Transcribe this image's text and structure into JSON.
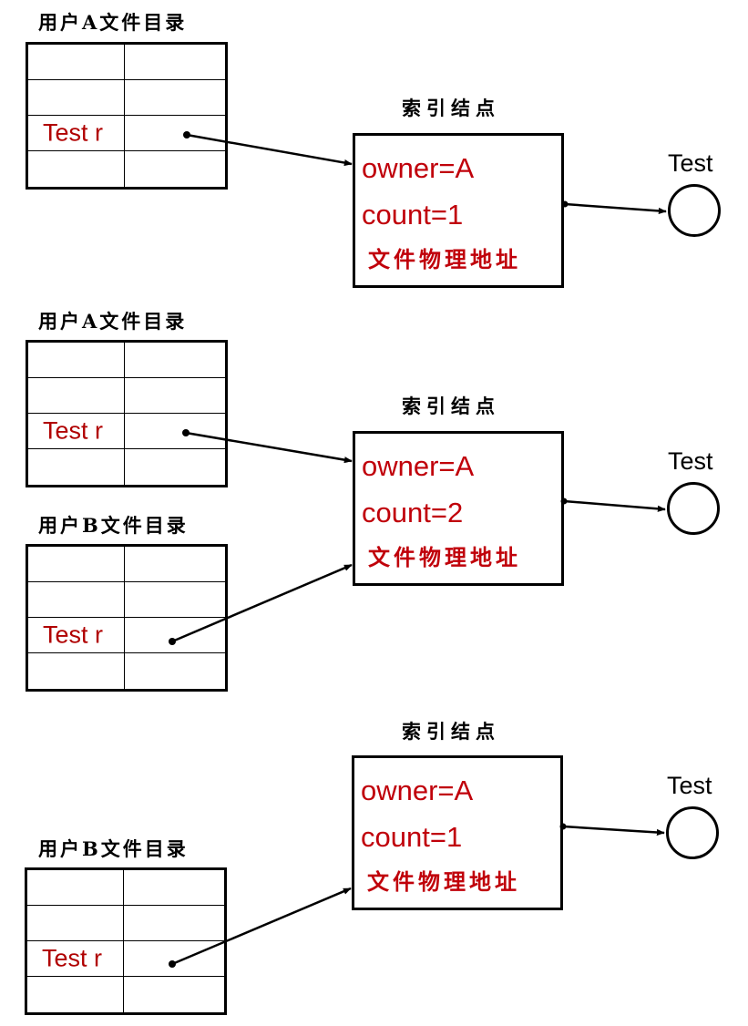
{
  "panels": [
    {
      "directories": [
        {
          "title": "用户A文件目录",
          "entry": "Test r"
        }
      ],
      "inode": {
        "title": "索引结点",
        "owner": "owner=A",
        "count": "count=1",
        "address": "文件物理地址"
      },
      "file": {
        "label": "Test"
      }
    },
    {
      "directories": [
        {
          "title": "用户A文件目录",
          "entry": "Test r"
        },
        {
          "title": "用户B文件目录",
          "entry": "Test r"
        }
      ],
      "inode": {
        "title": "索引结点",
        "owner": "owner=A",
        "count": "count=2",
        "address": "文件物理地址"
      },
      "file": {
        "label": "Test"
      }
    },
    {
      "directories": [
        {
          "title": "用户B文件目录",
          "entry": "Test r"
        }
      ],
      "inode": {
        "title": "索引结点",
        "owner": "owner=A",
        "count": "count=1",
        "address": "文件物理地址"
      },
      "file": {
        "label": "Test"
      }
    }
  ],
  "colors": {
    "entry_text": "#b00000",
    "inode_text": "#c0000a",
    "line": "#000000"
  }
}
